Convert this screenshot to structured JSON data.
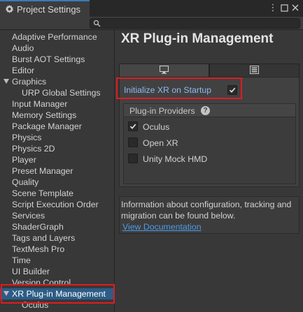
{
  "window": {
    "tab_title": "Project Settings",
    "menu_glyph": "⋮",
    "maximize_glyph": "□",
    "close_glyph": "✕"
  },
  "search": {
    "placeholder": ""
  },
  "sidebar": {
    "items": [
      {
        "label": "Adaptive Performance"
      },
      {
        "label": "Audio"
      },
      {
        "label": "Burst AOT Settings"
      },
      {
        "label": "Editor"
      },
      {
        "label": "Graphics"
      },
      {
        "label": "URP Global Settings"
      },
      {
        "label": "Input Manager"
      },
      {
        "label": "Memory Settings"
      },
      {
        "label": "Package Manager"
      },
      {
        "label": "Physics"
      },
      {
        "label": "Physics 2D"
      },
      {
        "label": "Player"
      },
      {
        "label": "Preset Manager"
      },
      {
        "label": "Quality"
      },
      {
        "label": "Scene Template"
      },
      {
        "label": "Script Execution Order"
      },
      {
        "label": "Services"
      },
      {
        "label": "ShaderGraph"
      },
      {
        "label": "Tags and Layers"
      },
      {
        "label": "TextMesh Pro"
      },
      {
        "label": "Time"
      },
      {
        "label": "UI Builder"
      },
      {
        "label": "Version Control"
      },
      {
        "label": "XR Plug-in Management"
      },
      {
        "label": "Oculus"
      }
    ]
  },
  "main": {
    "title": "XR Plug-in Management",
    "tabs": [
      {
        "name": "desktop-icon",
        "active": true
      },
      {
        "name": "android-icon",
        "active": false
      }
    ],
    "initialize_label": "Initialize XR on Startup",
    "initialize_checked": true,
    "providers_header": "Plug-in Providers",
    "help_glyph": "?",
    "providers": [
      {
        "label": "Oculus",
        "checked": true
      },
      {
        "label": "Open XR",
        "checked": false
      },
      {
        "label": "Unity Mock HMD",
        "checked": false
      }
    ],
    "info_text": "Information about configuration, tracking and migration can be found below.",
    "doc_link": "View Documentation"
  },
  "colors": {
    "selection": "#2c5d87",
    "highlight_box": "#e11b22",
    "link": "#4c9be8",
    "init_label": "#8fbaf2"
  }
}
